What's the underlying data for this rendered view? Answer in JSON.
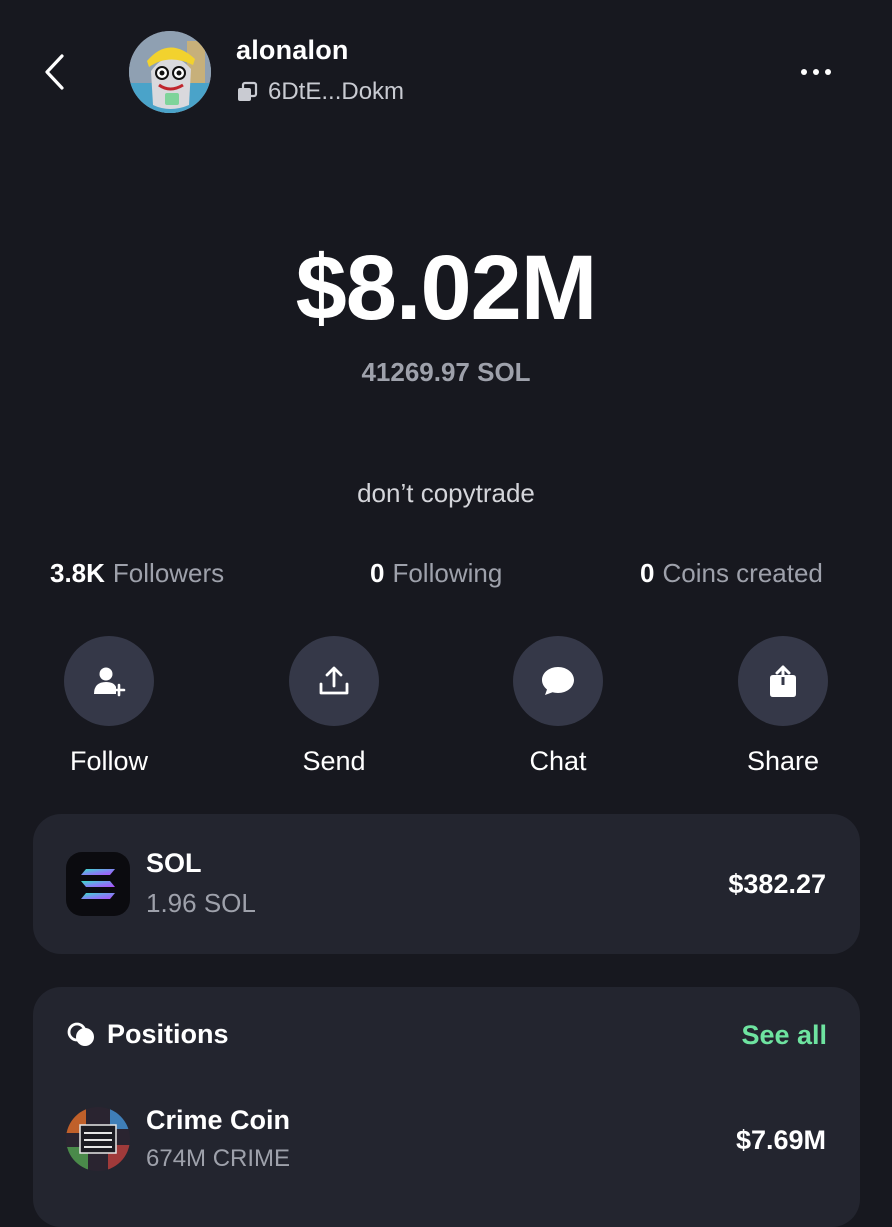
{
  "header": {
    "username": "alonalon",
    "address": "6DtE...Dokm"
  },
  "balance": {
    "usd": "$8.02M",
    "sol": "41269.97 SOL"
  },
  "bio": "don’t copytrade",
  "stats": [
    {
      "value": "3.8K",
      "label": "Followers"
    },
    {
      "value": "0",
      "label": "Following"
    },
    {
      "value": "0",
      "label": "Coins created"
    }
  ],
  "actions": [
    {
      "label": "Follow",
      "icon": "add-user-icon"
    },
    {
      "label": "Send",
      "icon": "upload-icon"
    },
    {
      "label": "Chat",
      "icon": "chat-bubble-icon"
    },
    {
      "label": "Share",
      "icon": "share-icon"
    }
  ],
  "sol_holding": {
    "name": "SOL",
    "amount": "1.96 SOL",
    "value": "$382.27"
  },
  "positions": {
    "title": "Positions",
    "see_all": "See all",
    "items": [
      {
        "name": "Crime Coin",
        "amount": "674M CRIME",
        "value": "$7.69M"
      }
    ]
  },
  "colors": {
    "background": "#17181f",
    "card": "#23252f",
    "button_circle": "#353848",
    "accent_green": "#6ee3a0",
    "muted_text": "#9ea1ab"
  }
}
